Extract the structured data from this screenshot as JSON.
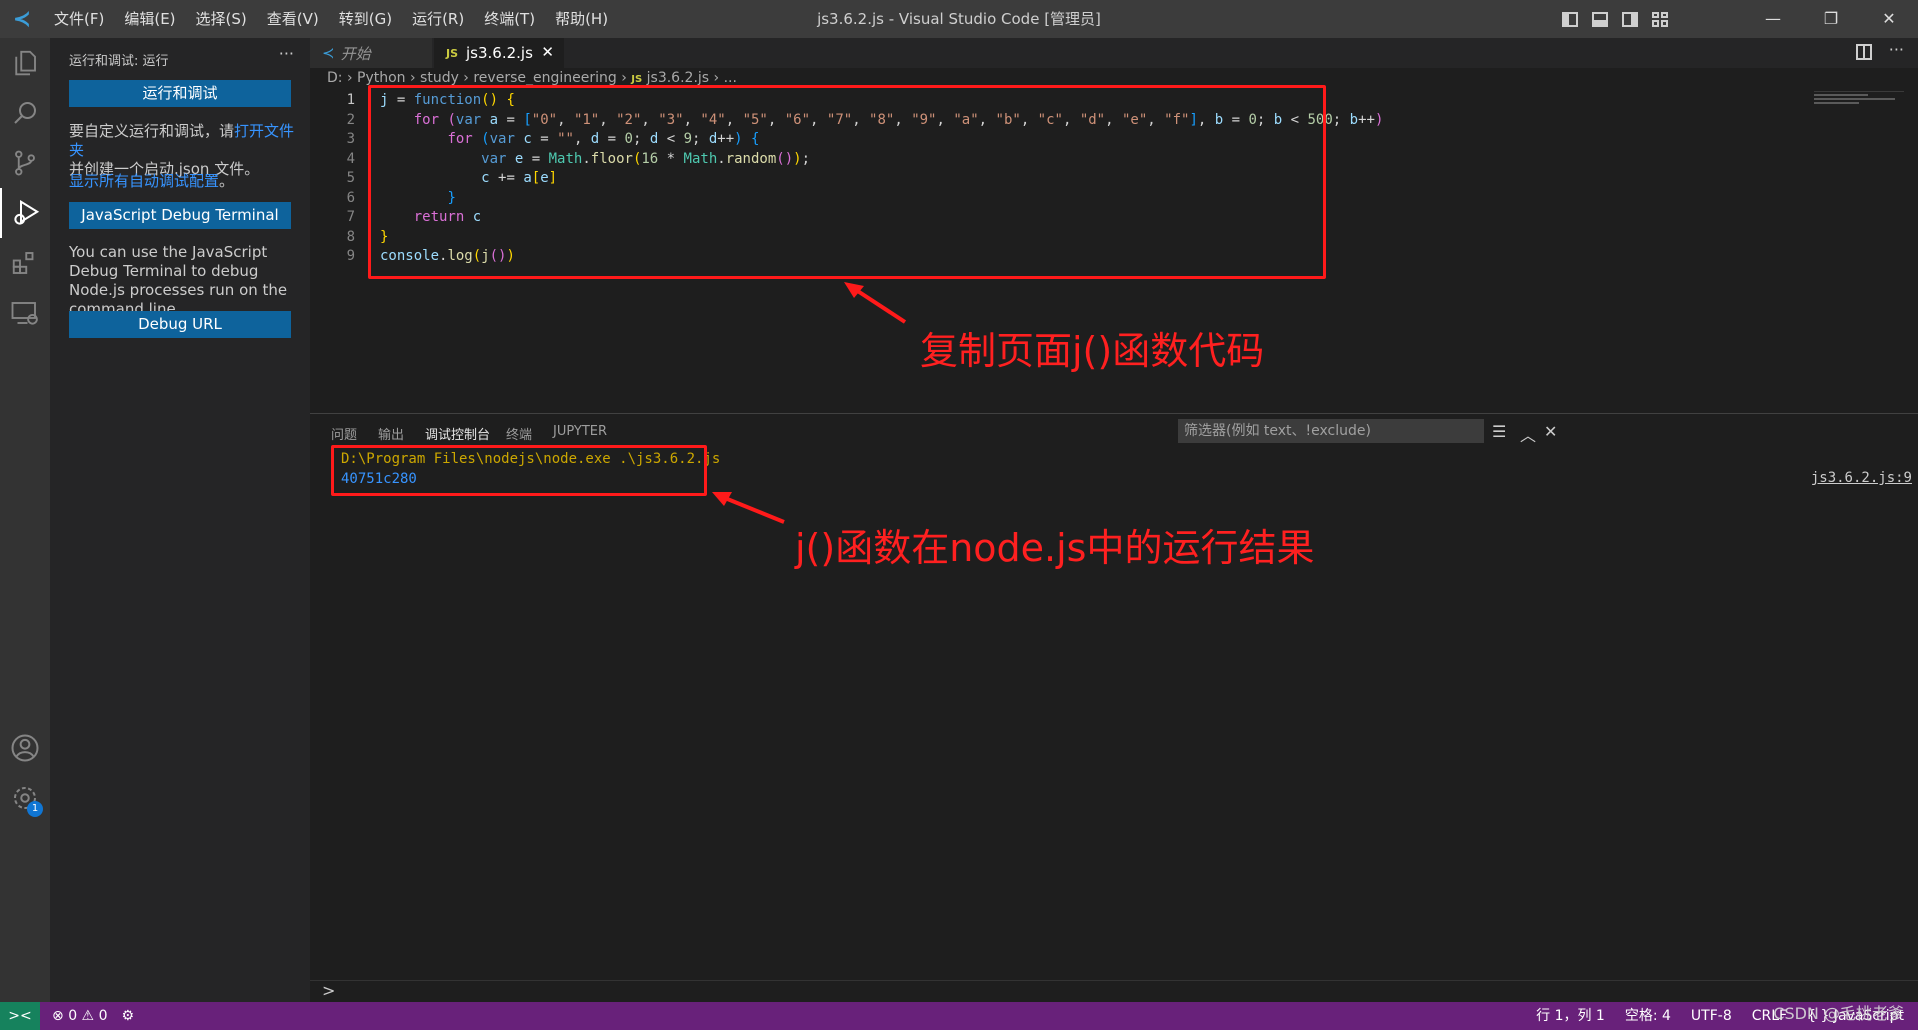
{
  "window": {
    "title": "js3.6.2.js - Visual Studio Code [管理员]",
    "menu": [
      "文件(F)",
      "编辑(E)",
      "选择(S)",
      "查看(V)",
      "转到(G)",
      "运行(R)",
      "终端(T)",
      "帮助(H)"
    ],
    "controls": {
      "minimize": "—",
      "restore": "❐",
      "close": "✕"
    }
  },
  "activity_bar": {
    "icons": [
      "explorer-icon",
      "search-icon",
      "source-control-icon",
      "run-debug-icon",
      "extensions-icon",
      "remote-explorer-icon",
      "accounts-icon",
      "settings-gear-icon"
    ],
    "settings_badge": "1"
  },
  "sidebar": {
    "header": "运行和调试: 运行",
    "more": "···",
    "run_debug_button": "运行和调试",
    "customize_text_1": "要自定义运行和调试，请",
    "open_folder_link": "打开文件夹",
    "customize_text_2": "并创建一个启动.json 文件。",
    "show_all_link": "显示所有自动调试配置",
    "show_all_suffix": "。",
    "js_debug_terminal_button": "JavaScript Debug Terminal",
    "js_debug_desc": "You can use the JavaScript Debug Terminal to debug Node.js processes run on the command line.",
    "debug_url_button": "Debug URL"
  },
  "editor": {
    "tabs": [
      {
        "label": "开始",
        "active": false
      },
      {
        "label": "js3.6.2.js",
        "icon": "JS",
        "active": true,
        "close": "✕"
      }
    ],
    "breadcrumb": {
      "parts": [
        "D:",
        "Python",
        "study",
        "reverse_engineering"
      ],
      "file_icon": "JS",
      "file": "js3.6.2.js",
      "tail": "..."
    },
    "line_numbers": [
      "1",
      "2",
      "3",
      "4",
      "5",
      "6",
      "7",
      "8",
      "9"
    ]
  },
  "annotations": {
    "code_note": "复制页面j()函数代码",
    "result_note": "j()函数在node.js中的运行结果"
  },
  "panel": {
    "tabs": [
      "问题",
      "输出",
      "调试控制台",
      "终端",
      "JUPYTER"
    ],
    "active_tab": "调试控制台",
    "filter_placeholder": "筛选器(例如 text、!exclude)",
    "output_lines": [
      "D:\\Program Files\\nodejs\\node.exe .\\js3.6.2.js",
      "40751c280"
    ],
    "source_link": "js3.6.2.js:9",
    "prompt": ">"
  },
  "status_bar": {
    "remote": "><",
    "errors": "0",
    "warnings": "0",
    "right_items": [
      "行 1，列 1",
      "空格: 4",
      "UTF-8",
      "CRLF",
      "{ } JavaScript"
    ],
    "colors": {
      "background": "#68217a",
      "remote_bg": "#16825d"
    }
  },
  "watermark": "CSDN @毛桃老爹"
}
